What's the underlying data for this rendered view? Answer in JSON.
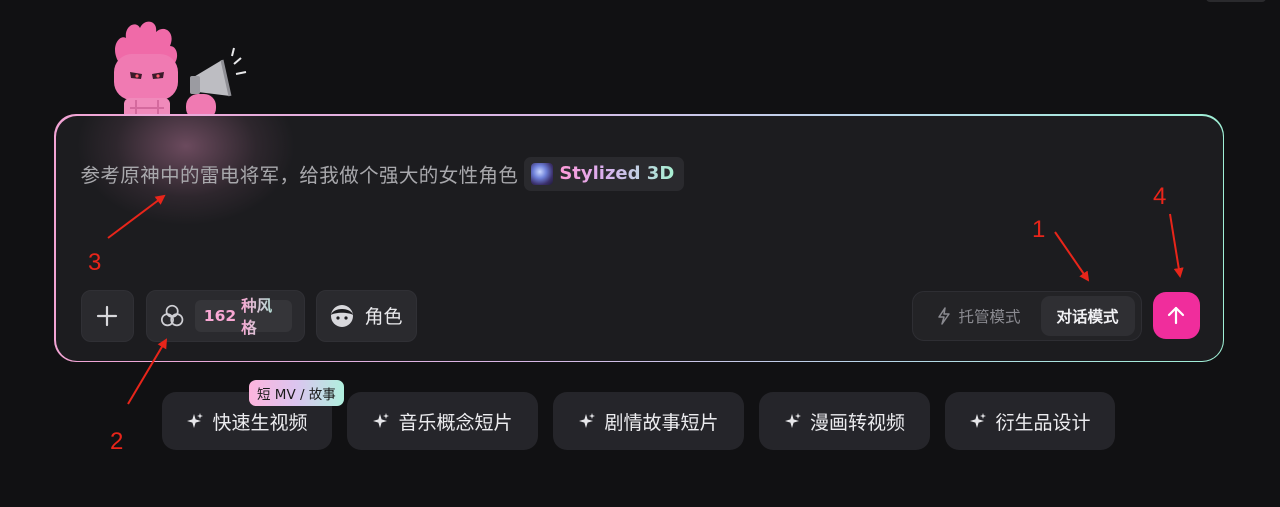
{
  "prompt": {
    "text": "参考原神中的雷电将军，给我做个强大的女性角色",
    "style_chip_label": "Stylized 3D"
  },
  "toolbar": {
    "add_label": "",
    "styles_count": "162",
    "styles_unit": "种风格",
    "role_label": "角色"
  },
  "mode_switch": {
    "auto_label": "托管模式",
    "chat_label": "对话模式",
    "selected": "对话模式"
  },
  "chip_tag": "短 MV / 故事",
  "quick_chips": [
    {
      "label": "快速生视频",
      "icon": "sparkle-icon"
    },
    {
      "label": "音乐概念短片",
      "icon": "sparkle-icon"
    },
    {
      "label": "剧情故事短片",
      "icon": "sparkle-icon"
    },
    {
      "label": "漫画转视频",
      "icon": "sparkle-icon"
    },
    {
      "label": "衍生品设计",
      "icon": "sparkle-icon"
    }
  ],
  "annotations": [
    "1",
    "2",
    "3",
    "4"
  ],
  "colors": {
    "accent": "#f02d9c",
    "annotation": "#e8251a",
    "background": "#111113",
    "card": "#1c1c1f"
  }
}
